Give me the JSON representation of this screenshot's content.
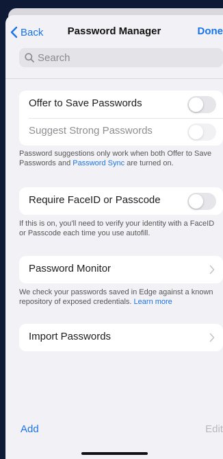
{
  "nav": {
    "back_label": "Back",
    "title": "Password Manager",
    "done_label": "Done"
  },
  "search": {
    "placeholder": "Search"
  },
  "section1": {
    "offer_label": "Offer to Save Passwords",
    "suggest_label": "Suggest Strong Passwords",
    "note_prefix": "Password suggestions only work when both Offer to Save Passwords and ",
    "note_link": "Password Sync",
    "note_suffix": " are turned on."
  },
  "section2": {
    "label": "Require FaceID or Passcode",
    "note": "If this is on, you'll need to verify your identity with a FaceID or Passcode each time you use autofill."
  },
  "section3": {
    "label": "Password Monitor",
    "note_prefix": "We check your passwords saved in Edge against a known repository of exposed credentials. ",
    "note_link": "Learn more"
  },
  "section4": {
    "label": "Import Passwords"
  },
  "toolbar": {
    "add_label": "Add",
    "edit_label": "Edit"
  },
  "colors": {
    "accent": "#1a73e8",
    "background": "#f2f2f6"
  },
  "icons": {
    "back": "chevron-left-icon",
    "search": "magnifier-icon",
    "row_nav": "chevron-right-icon"
  }
}
